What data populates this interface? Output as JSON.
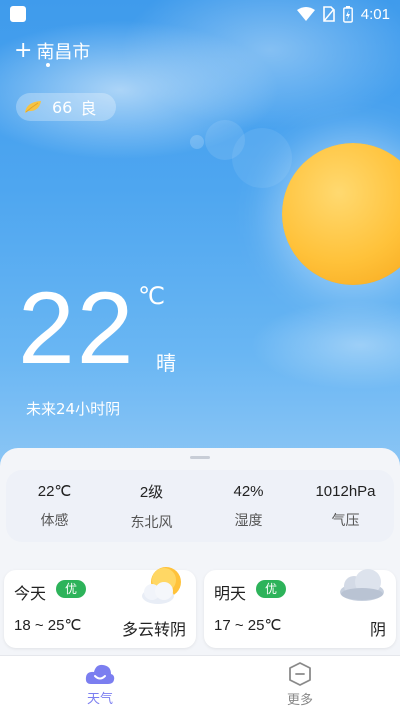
{
  "status_bar": {
    "time": "4:01"
  },
  "location": {
    "city": "南昌市"
  },
  "air_quality": {
    "value": "66",
    "level": "良"
  },
  "current": {
    "temperature": "22",
    "unit": "℃",
    "condition": "晴",
    "forecast_note": "未来24小时阴"
  },
  "details": [
    {
      "value": "22℃",
      "label": "体感"
    },
    {
      "value": "2级",
      "label": "东北风"
    },
    {
      "value": "42%",
      "label": "湿度"
    },
    {
      "value": "1012hPa",
      "label": "气压"
    }
  ],
  "days": [
    {
      "name": "今天",
      "badge": "优",
      "range": "18 ~ 25℃",
      "condition": "多云转阴",
      "icon": "partly-cloudy-sun-icon"
    },
    {
      "name": "明天",
      "badge": "优",
      "range": "17 ~ 25℃",
      "condition": "阴",
      "icon": "cloud-icon"
    }
  ],
  "tabs": [
    {
      "label": "天气",
      "icon": "weather-tab-icon",
      "active": true
    },
    {
      "label": "更多",
      "icon": "more-tab-icon",
      "active": false
    }
  ],
  "colors": {
    "sky_top": "#3f9bec",
    "accent": "#7b7ef0",
    "badge_green": "#2db35a",
    "sun": "#ffc23a"
  }
}
